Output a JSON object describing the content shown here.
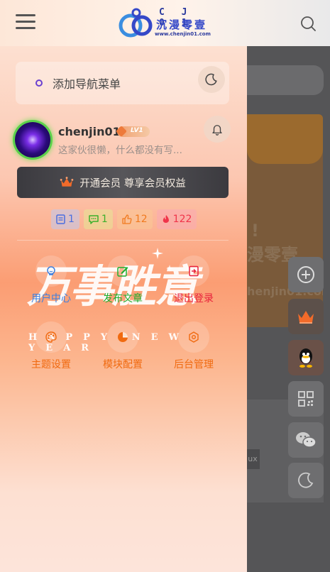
{
  "header": {
    "logo": {
      "top": "C J 0 1",
      "mid": "沉漫零壹",
      "url": "www.chenjin01.com"
    }
  },
  "drawer": {
    "nav_add_label": "添加导航菜单",
    "user": {
      "name": "chenjin01",
      "level": "LV1",
      "desc": "这家伙很懒，什么都没有写..."
    },
    "vip_label": "开通会员 尊享会员权益",
    "stats": [
      {
        "icon": "article-icon",
        "value": "1",
        "color": "#4a6ee0",
        "bg": "rgba(190,200,240,0.55)"
      },
      {
        "icon": "comment-icon",
        "value": "1",
        "color": "#3bb02c",
        "bg": "rgba(230,230,150,0.55)"
      },
      {
        "icon": "like-icon",
        "value": "12",
        "color": "#f07a1e",
        "bg": "rgba(250,200,150,0.55)"
      },
      {
        "icon": "fire-icon",
        "value": "122",
        "color": "#f0344a",
        "bg": "rgba(250,170,180,0.55)"
      }
    ],
    "menu_row1": [
      {
        "label": "用户中心",
        "color": "#3c7fe0",
        "icon": "user-icon"
      },
      {
        "label": "发布文章",
        "color": "#1fae2e",
        "icon": "edit-icon"
      },
      {
        "label": "退出登录",
        "color": "#e8213b",
        "icon": "logout-icon"
      }
    ],
    "menu_row2": [
      {
        "label": "主题设置",
        "color": "#f06a10",
        "icon": "palette-icon"
      },
      {
        "label": "模块配置",
        "color": "#f06a10",
        "icon": "pie-icon"
      },
      {
        "label": "后台管理",
        "color": "#f06a10",
        "icon": "settings-icon"
      }
    ],
    "banner_text": "万事胜意",
    "banner_sub": "HAPPY NEW YEAR"
  },
  "background": {
    "banner_text_1": "!",
    "banner_text_2": "漫零壹",
    "banner_url": "henjin01.com",
    "tag": "ux"
  },
  "colors": {
    "accent": "#f06a10",
    "drawer_top": "#fde0d1",
    "drawer_mid": "#fb9d73"
  }
}
